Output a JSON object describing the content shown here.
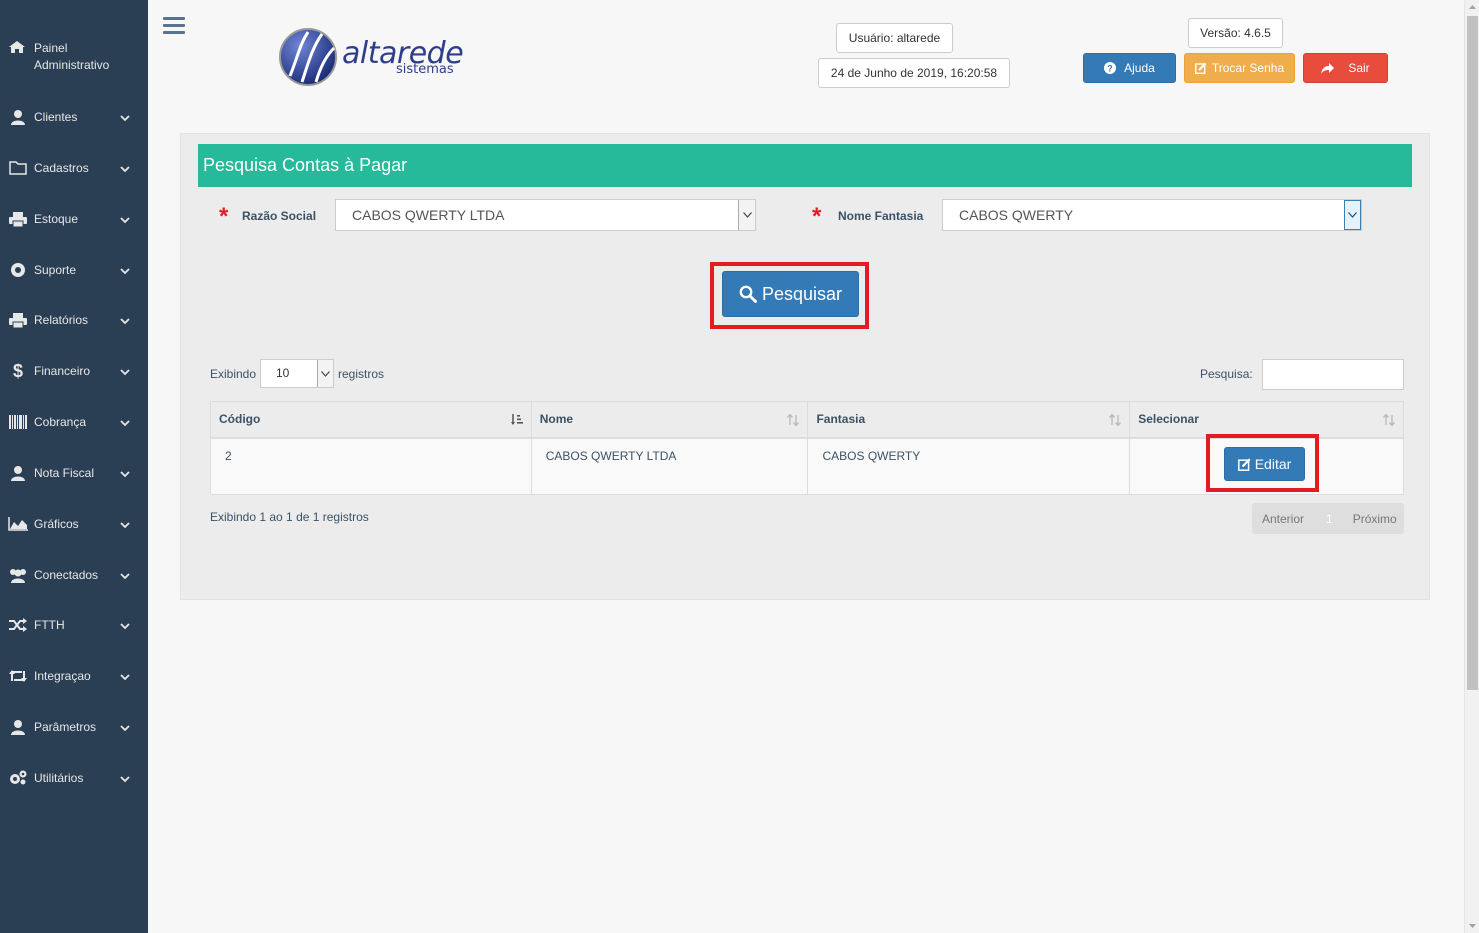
{
  "sidebar": {
    "header": "Painel\nAdministrativo",
    "header_line1": "Painel",
    "header_line2": "Administrativo",
    "items": [
      {
        "label": "Clientes",
        "icon": "user-icon"
      },
      {
        "label": "Cadastros",
        "icon": "folder-icon"
      },
      {
        "label": "Estoque",
        "icon": "printer-icon"
      },
      {
        "label": "Suporte",
        "icon": "life-ring-icon"
      },
      {
        "label": "Relatórios",
        "icon": "printer-icon"
      },
      {
        "label": "Financeiro",
        "icon": "dollar-icon"
      },
      {
        "label": "Cobrança",
        "icon": "barcode-icon"
      },
      {
        "label": "Nota Fiscal",
        "icon": "user-icon"
      },
      {
        "label": "Gráficos",
        "icon": "area-chart-icon"
      },
      {
        "label": "Conectados",
        "icon": "users-icon"
      },
      {
        "label": "FTTH",
        "icon": "random-icon"
      },
      {
        "label": "Integraçao",
        "icon": "retweet-icon"
      },
      {
        "label": "Parâmetros",
        "icon": "user-icon"
      },
      {
        "label": "Utilitários",
        "icon": "cogs-icon"
      }
    ]
  },
  "header": {
    "logo_word": "altarede",
    "logo_sub": "sistemas",
    "user": "Usuário: altarede",
    "datetime": "24 de Junho de 2019, 16:20:58",
    "version": "Versão: 4.6.5",
    "help_label": "Ajuda",
    "change_password_label": "Trocar Senha",
    "logout_label": "Sair"
  },
  "colors": {
    "sidebar": "#2a3f54",
    "title_bar": "#26b99a",
    "primary": "#337ab7",
    "warning": "#f0ad4e",
    "danger": "#e74c3c",
    "highlight": "#e31b23"
  },
  "form": {
    "title": "Pesquisa Contas à Pagar",
    "razao_label": "Razão Social",
    "razao_value": "CABOS QWERTY LTDA",
    "fantasia_label": "Nome Fantasia",
    "fantasia_value": "CABOS QWERTY",
    "search_button": "Pesquisar"
  },
  "table": {
    "length_prefix": "Exibindo",
    "length_value": "10",
    "length_suffix": "registros",
    "search_label": "Pesquisa:",
    "search_value": "",
    "columns": [
      "Código",
      "Nome",
      "Fantasia",
      "Selecionar"
    ],
    "rows": [
      {
        "codigo": "2",
        "nome": "CABOS QWERTY LTDA",
        "fantasia": "CABOS QWERTY",
        "action": "Editar"
      }
    ],
    "info": "Exibindo 1 ao 1 de 1 registros",
    "pager": {
      "prev": "Anterior",
      "page": "1",
      "next": "Próximo"
    }
  }
}
